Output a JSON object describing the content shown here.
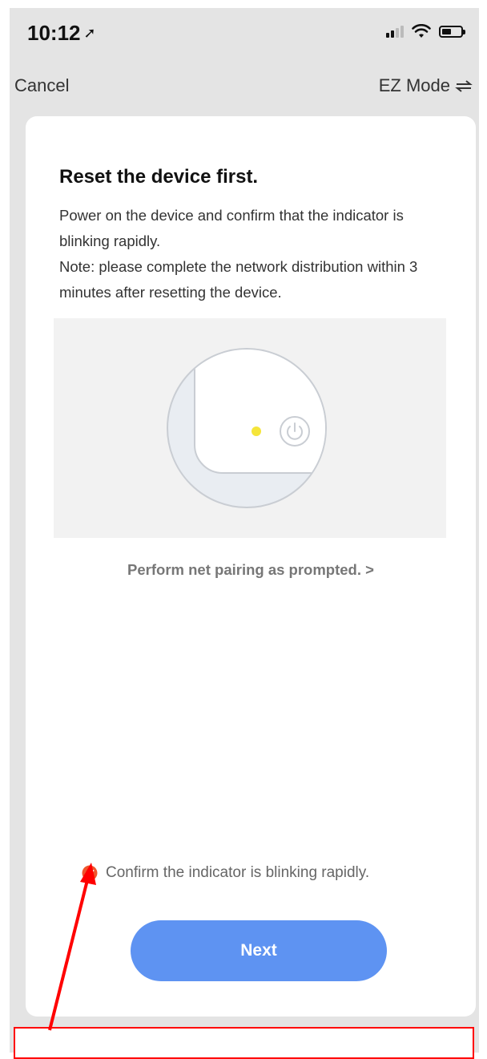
{
  "status_bar": {
    "time": "10:12",
    "location_icon": "location-arrow-icon",
    "signal_icon": "cellular-signal-icon",
    "wifi_icon": "wifi-icon",
    "battery_icon": "battery-icon"
  },
  "nav": {
    "cancel_label": "Cancel",
    "mode_label": "EZ Mode",
    "mode_icon": "switch-arrows-icon"
  },
  "card": {
    "title": "Reset the device first.",
    "description_line1": "Power on the device and confirm that the indicator is blinking rapidly.",
    "description_line2": "Note: please complete the network distribution within 3 minutes after resetting the device.",
    "illustration_icons": [
      "indicator-light-icon",
      "power-button-icon"
    ],
    "pairing_link": "Perform net pairing as prompted. >",
    "confirm_label": "Confirm the indicator is blinking rapidly.",
    "confirm_checked": true,
    "next_button": "Next"
  },
  "colors": {
    "accent_blue": "#5e93f2",
    "check_orange": "#f0552d",
    "indicator_yellow": "#f5e53a",
    "annotation_red": "#ff0000",
    "screen_bg": "#e4e4e4"
  }
}
